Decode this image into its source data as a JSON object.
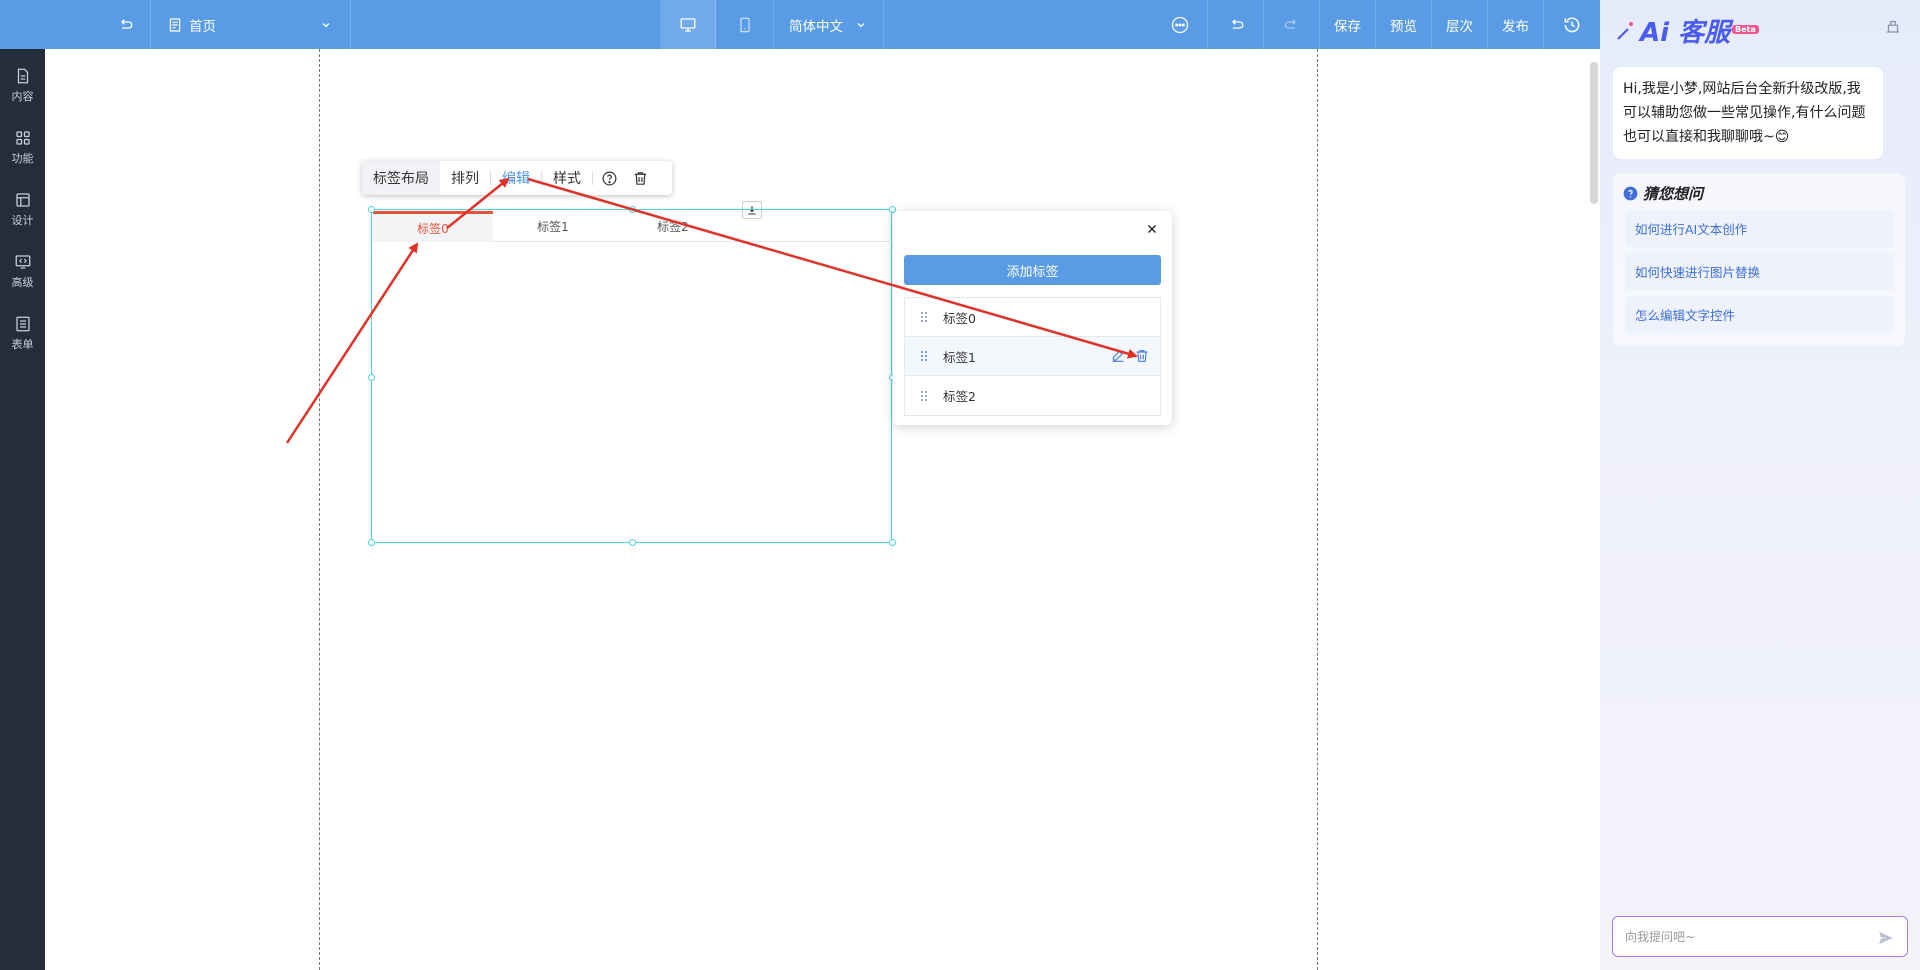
{
  "topbar": {
    "page_name": "首页",
    "language": "简体中文",
    "save": "保存",
    "preview": "预览",
    "layers": "层次",
    "publish": "发布"
  },
  "sidebar": {
    "items": [
      {
        "label": "内容",
        "icon": "file-icon"
      },
      {
        "label": "功能",
        "icon": "grid-icon"
      },
      {
        "label": "设计",
        "icon": "layout-icon"
      },
      {
        "label": "高级",
        "icon": "code-monitor-icon"
      },
      {
        "label": "表单",
        "icon": "form-icon"
      }
    ]
  },
  "float_toolbar": {
    "layout": "标签布局",
    "arrange": "排列",
    "edit": "编辑",
    "style": "样式"
  },
  "tab_widget": {
    "tabs": [
      "标签0",
      "标签1",
      "标签2"
    ],
    "selected_index": 0
  },
  "edit_popup": {
    "add_button": "添加标签",
    "items": [
      "标签0",
      "标签1",
      "标签2"
    ]
  },
  "ai_panel": {
    "title": "Ai 客服",
    "badge": "Beta",
    "greeting": "Hi,我是小梦,网站后台全新升级改版,我可以辅助您做一些常见操作,有什么问题也可以直接和我聊聊哦~😊",
    "guess_title": "猜您想问",
    "questions": [
      "如何进行AI文本创作",
      "如何快速进行图片替换",
      "怎么编辑文字控件"
    ],
    "input_placeholder": "向我提问吧~"
  },
  "colors": {
    "topbar": "#5a9be6",
    "sidebar": "#242d3b",
    "accent": "#4a90e2",
    "tab_selected": "#e5533d",
    "annotation_arrow": "#e03228"
  }
}
